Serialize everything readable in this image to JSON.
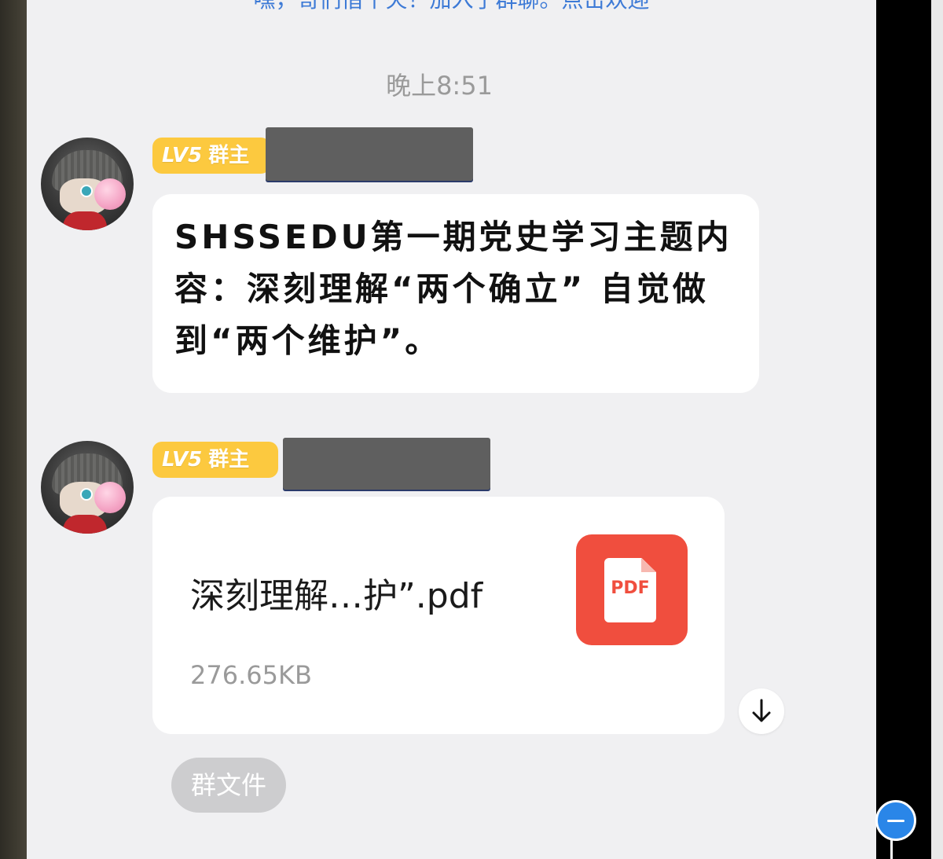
{
  "system_message": "嘿，哥们借个火！加入了群聊。点击欢迎",
  "timestamp": "晚上8:51",
  "messages": [
    {
      "badge_level": "LV5",
      "badge_role": "群主",
      "text": "SHSSEDU第一期党史学习主题内容：深刻理解“两个确立” 自觉做到“两个维护”。"
    },
    {
      "badge_level": "LV5",
      "badge_role": "群主",
      "file": {
        "name": "深刻理解…护”.pdf",
        "size": "276.65KB",
        "icon_label": "PDF",
        "icon_color": "#F04E3E"
      }
    }
  ],
  "chip_label": "群文件",
  "icons": {
    "download": "download-arrow-icon",
    "pdf": "pdf-file-icon",
    "fab": "minus-icon"
  },
  "colors": {
    "badge": "#FCC93F",
    "accent": "#2A86E8",
    "chat_background": "#F0F0F2"
  }
}
